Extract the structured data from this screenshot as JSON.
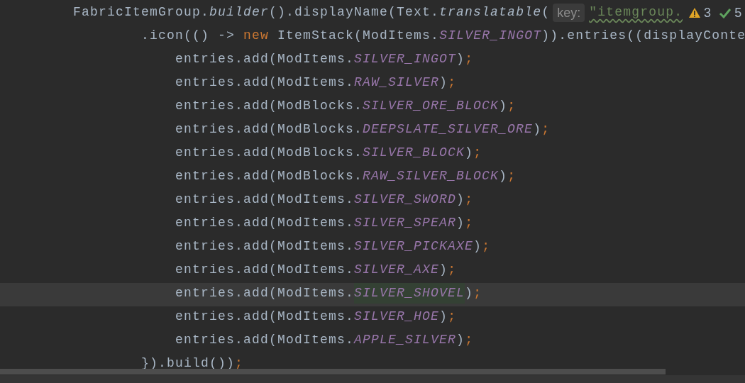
{
  "editor": {
    "lines": [
      {
        "current": false,
        "tokens": [
          {
            "kind": "plain",
            "text": "        FabricItemGroup."
          },
          {
            "kind": "italic",
            "text": "builder"
          },
          {
            "kind": "plain",
            "text": "().displayName(Text."
          },
          {
            "kind": "italic",
            "text": "translatable"
          },
          {
            "kind": "plain",
            "text": "("
          },
          {
            "kind": "hint",
            "text": "key:"
          },
          {
            "kind": "string",
            "text": "\"itemgroup."
          }
        ]
      },
      {
        "current": false,
        "tokens": [
          {
            "kind": "plain",
            "text": "                .icon(() -> "
          },
          {
            "kind": "keyword",
            "text": "new"
          },
          {
            "kind": "plain",
            "text": " ItemStack(ModItems."
          },
          {
            "kind": "constant",
            "text": "SILVER_INGOT"
          },
          {
            "kind": "plain",
            "text": ")).entries((displayConte"
          }
        ]
      },
      {
        "current": false,
        "tokens": [
          {
            "kind": "plain",
            "text": "                    entries.add(ModItems."
          },
          {
            "kind": "constant",
            "text": "SILVER_INGOT"
          },
          {
            "kind": "plain",
            "text": ")"
          },
          {
            "kind": "punct",
            "text": ";"
          }
        ]
      },
      {
        "current": false,
        "tokens": [
          {
            "kind": "plain",
            "text": "                    entries.add(ModItems."
          },
          {
            "kind": "constant",
            "text": "RAW_SILVER"
          },
          {
            "kind": "plain",
            "text": ")"
          },
          {
            "kind": "punct",
            "text": ";"
          }
        ]
      },
      {
        "current": false,
        "tokens": [
          {
            "kind": "plain",
            "text": "                    entries.add(ModBlocks."
          },
          {
            "kind": "constant",
            "text": "SILVER_ORE_BLOCK"
          },
          {
            "kind": "plain",
            "text": ")"
          },
          {
            "kind": "punct",
            "text": ";"
          }
        ]
      },
      {
        "current": false,
        "tokens": [
          {
            "kind": "plain",
            "text": "                    entries.add(ModBlocks."
          },
          {
            "kind": "constant",
            "text": "DEEPSLATE_SILVER_ORE"
          },
          {
            "kind": "plain",
            "text": ")"
          },
          {
            "kind": "punct",
            "text": ";"
          }
        ]
      },
      {
        "current": false,
        "tokens": [
          {
            "kind": "plain",
            "text": "                    entries.add(ModBlocks."
          },
          {
            "kind": "constant",
            "text": "SILVER_BLOCK"
          },
          {
            "kind": "plain",
            "text": ")"
          },
          {
            "kind": "punct",
            "text": ";"
          }
        ]
      },
      {
        "current": false,
        "tokens": [
          {
            "kind": "plain",
            "text": "                    entries.add(ModBlocks."
          },
          {
            "kind": "constant",
            "text": "RAW_SILVER_BLOCK"
          },
          {
            "kind": "plain",
            "text": ")"
          },
          {
            "kind": "punct",
            "text": ";"
          }
        ]
      },
      {
        "current": false,
        "tokens": [
          {
            "kind": "plain",
            "text": "                    entries.add(ModItems."
          },
          {
            "kind": "constant",
            "text": "SILVER_SWORD"
          },
          {
            "kind": "plain",
            "text": ")"
          },
          {
            "kind": "punct",
            "text": ";"
          }
        ]
      },
      {
        "current": false,
        "tokens": [
          {
            "kind": "plain",
            "text": "                    entries.add(ModItems."
          },
          {
            "kind": "constant",
            "text": "SILVER_SPEAR"
          },
          {
            "kind": "plain",
            "text": ")"
          },
          {
            "kind": "punct",
            "text": ";"
          }
        ]
      },
      {
        "current": false,
        "tokens": [
          {
            "kind": "plain",
            "text": "                    entries.add(ModItems."
          },
          {
            "kind": "constant",
            "text": "SILVER_PICKAXE"
          },
          {
            "kind": "plain",
            "text": ")"
          },
          {
            "kind": "punct",
            "text": ";"
          }
        ]
      },
      {
        "current": false,
        "tokens": [
          {
            "kind": "plain",
            "text": "                    entries.add(ModItems."
          },
          {
            "kind": "constant",
            "text": "SILVER_AXE"
          },
          {
            "kind": "plain",
            "text": ")"
          },
          {
            "kind": "punct",
            "text": ";"
          }
        ]
      },
      {
        "current": true,
        "tokens": [
          {
            "kind": "plain",
            "text": "                    entries.add(ModItems."
          },
          {
            "kind": "constant_match",
            "text": "SILVER_SHOVEL"
          },
          {
            "kind": "plain",
            "text": ")"
          },
          {
            "kind": "punct",
            "text": ";"
          }
        ]
      },
      {
        "current": false,
        "tokens": [
          {
            "kind": "plain",
            "text": "                    entries.add(ModItems."
          },
          {
            "kind": "constant",
            "text": "SILVER_HOE"
          },
          {
            "kind": "plain",
            "text": ")"
          },
          {
            "kind": "punct",
            "text": ";"
          }
        ]
      },
      {
        "current": false,
        "tokens": [
          {
            "kind": "plain",
            "text": "                    entries.add(ModItems."
          },
          {
            "kind": "constant",
            "text": "APPLE_SILVER"
          },
          {
            "kind": "plain",
            "text": ")"
          },
          {
            "kind": "punct",
            "text": ";"
          }
        ]
      },
      {
        "current": false,
        "tokens": [
          {
            "kind": "plain",
            "text": "                }).build())"
          },
          {
            "kind": "punct",
            "text": ";"
          }
        ]
      }
    ]
  },
  "inspections": {
    "warnings": "3",
    "passed": "5"
  }
}
